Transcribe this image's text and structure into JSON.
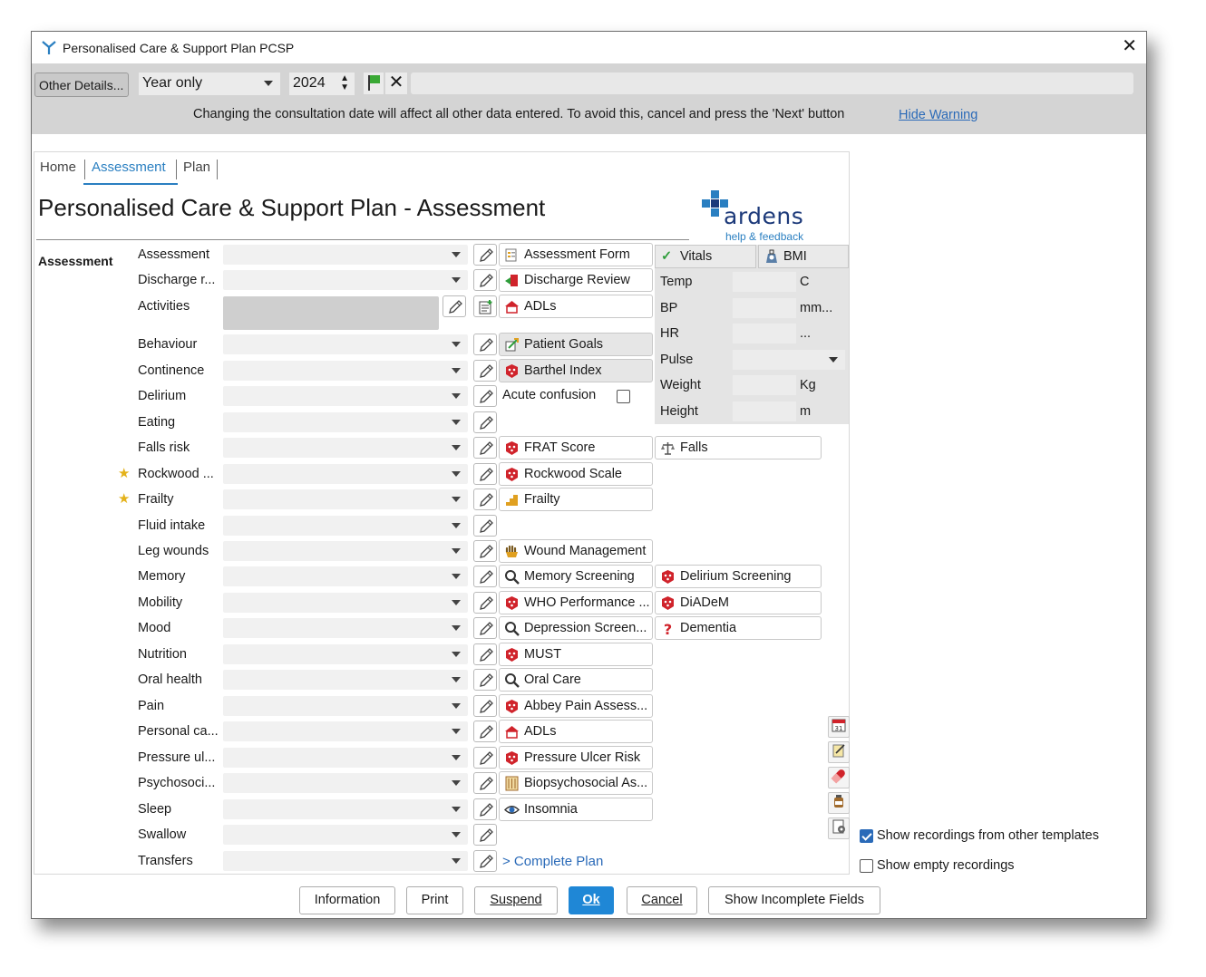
{
  "window": {
    "title": "Personalised Care & Support Plan PCSP",
    "close_glyph": "✕"
  },
  "datebar": {
    "other_details": "Other Details...",
    "date_mode": "Year only",
    "year": "2024",
    "warning": "Changing the consultation date will affect all other data entered. To avoid this, cancel and press the 'Next' button",
    "hide_warning": "Hide Warning"
  },
  "tabs": [
    {
      "label": "Home"
    },
    {
      "label": "Assessment"
    },
    {
      "label": "Plan"
    }
  ],
  "page": {
    "title": "Personalised Care & Support Plan - Assessment",
    "section_label": "Assessment"
  },
  "logo": {
    "word": "ardens",
    "help": "help & feedback"
  },
  "rows": [
    {
      "label": "Assessment",
      "link": "Assessment Form",
      "link_icon": "form-icon",
      "starred": false
    },
    {
      "label": "Discharge r...",
      "link": "Discharge Review",
      "link_icon": "discharge-icon",
      "starred": false
    },
    {
      "label": "Activities",
      "link": "ADLs",
      "link_icon": "house-icon",
      "starred": false
    },
    {
      "label": "Behaviour",
      "link": "Patient Goals",
      "link_icon": "goals-icon",
      "starred": false
    },
    {
      "label": "Continence",
      "link": "Barthel Index",
      "link_icon": "calculator-icon",
      "starred": false
    },
    {
      "label": "Delirium",
      "link": "Acute confusion",
      "checkbox": true,
      "starred": false
    },
    {
      "label": "Eating",
      "starred": false
    },
    {
      "label": "Falls risk",
      "link": "FRAT Score",
      "link_icon": "calculator-icon",
      "link2": "Falls",
      "link2_icon": "scales-icon",
      "starred": false
    },
    {
      "label": "Rockwood ...",
      "link": "Rockwood Scale",
      "link_icon": "calculator-icon",
      "starred": true
    },
    {
      "label": "Frailty",
      "link": "Frailty",
      "link_icon": "stairs-icon",
      "starred": true
    },
    {
      "label": "Fluid intake",
      "starred": false
    },
    {
      "label": "Leg wounds",
      "link": "Wound Management",
      "link_icon": "hand-icon",
      "starred": false
    },
    {
      "label": "Memory",
      "link": "Memory Screening",
      "link_icon": "search-icon",
      "link2": "Delirium Screening",
      "link2_icon": "calculator-icon",
      "starred": false
    },
    {
      "label": "Mobility",
      "link": "WHO Performance ...",
      "link_icon": "calculator-icon",
      "link2": "DiADeM",
      "link2_icon": "calculator-icon",
      "starred": false
    },
    {
      "label": "Mood",
      "link": "Depression Screen...",
      "link_icon": "search-icon",
      "link2": "Dementia",
      "link2_icon": "question-icon",
      "starred": false
    },
    {
      "label": "Nutrition",
      "link": "MUST",
      "link_icon": "calculator-icon",
      "starred": false
    },
    {
      "label": "Oral health",
      "link": "Oral Care",
      "link_icon": "search-icon",
      "starred": false
    },
    {
      "label": "Pain",
      "link": "Abbey Pain Assess...",
      "link_icon": "calculator-icon",
      "starred": false
    },
    {
      "label": "Personal ca...",
      "link": "ADLs",
      "link_icon": "house-icon",
      "starred": false
    },
    {
      "label": "Pressure ul...",
      "link": "Pressure Ulcer Risk",
      "link_icon": "calculator-icon",
      "starred": false
    },
    {
      "label": "Psychosoci...",
      "link": "Biopsychosocial As...",
      "link_icon": "abacus-icon",
      "starred": false
    },
    {
      "label": "Sleep",
      "link": "Insomnia",
      "link_icon": "eye-icon",
      "starred": false
    },
    {
      "label": "Swallow",
      "starred": false
    },
    {
      "label": "Transfers",
      "complete_link": "> Complete Plan",
      "starred": false
    }
  ],
  "vitals": {
    "vitals_btn": "Vitals",
    "bmi_btn": "BMI",
    "fields": [
      {
        "label": "Temp",
        "unit": "C"
      },
      {
        "label": "BP",
        "unit": "mm..."
      },
      {
        "label": "HR",
        "unit": "..."
      },
      {
        "label": "Pulse",
        "unit": ""
      },
      {
        "label": "Weight",
        "unit": "Kg"
      },
      {
        "label": "Height",
        "unit": "m"
      }
    ]
  },
  "options": {
    "show_other_templates": "Show recordings from other templates",
    "show_empty": "Show empty recordings"
  },
  "buttons": {
    "information": "Information",
    "print": "Print",
    "suspend": "Suspend",
    "ok": "Ok",
    "cancel": "Cancel",
    "show_incomplete": "Show Incomplete Fields"
  },
  "colors": {
    "accent": "#1f87d6",
    "link": "#2a6ab8",
    "star": "#e4b21a",
    "calc_red": "#d0232b"
  }
}
